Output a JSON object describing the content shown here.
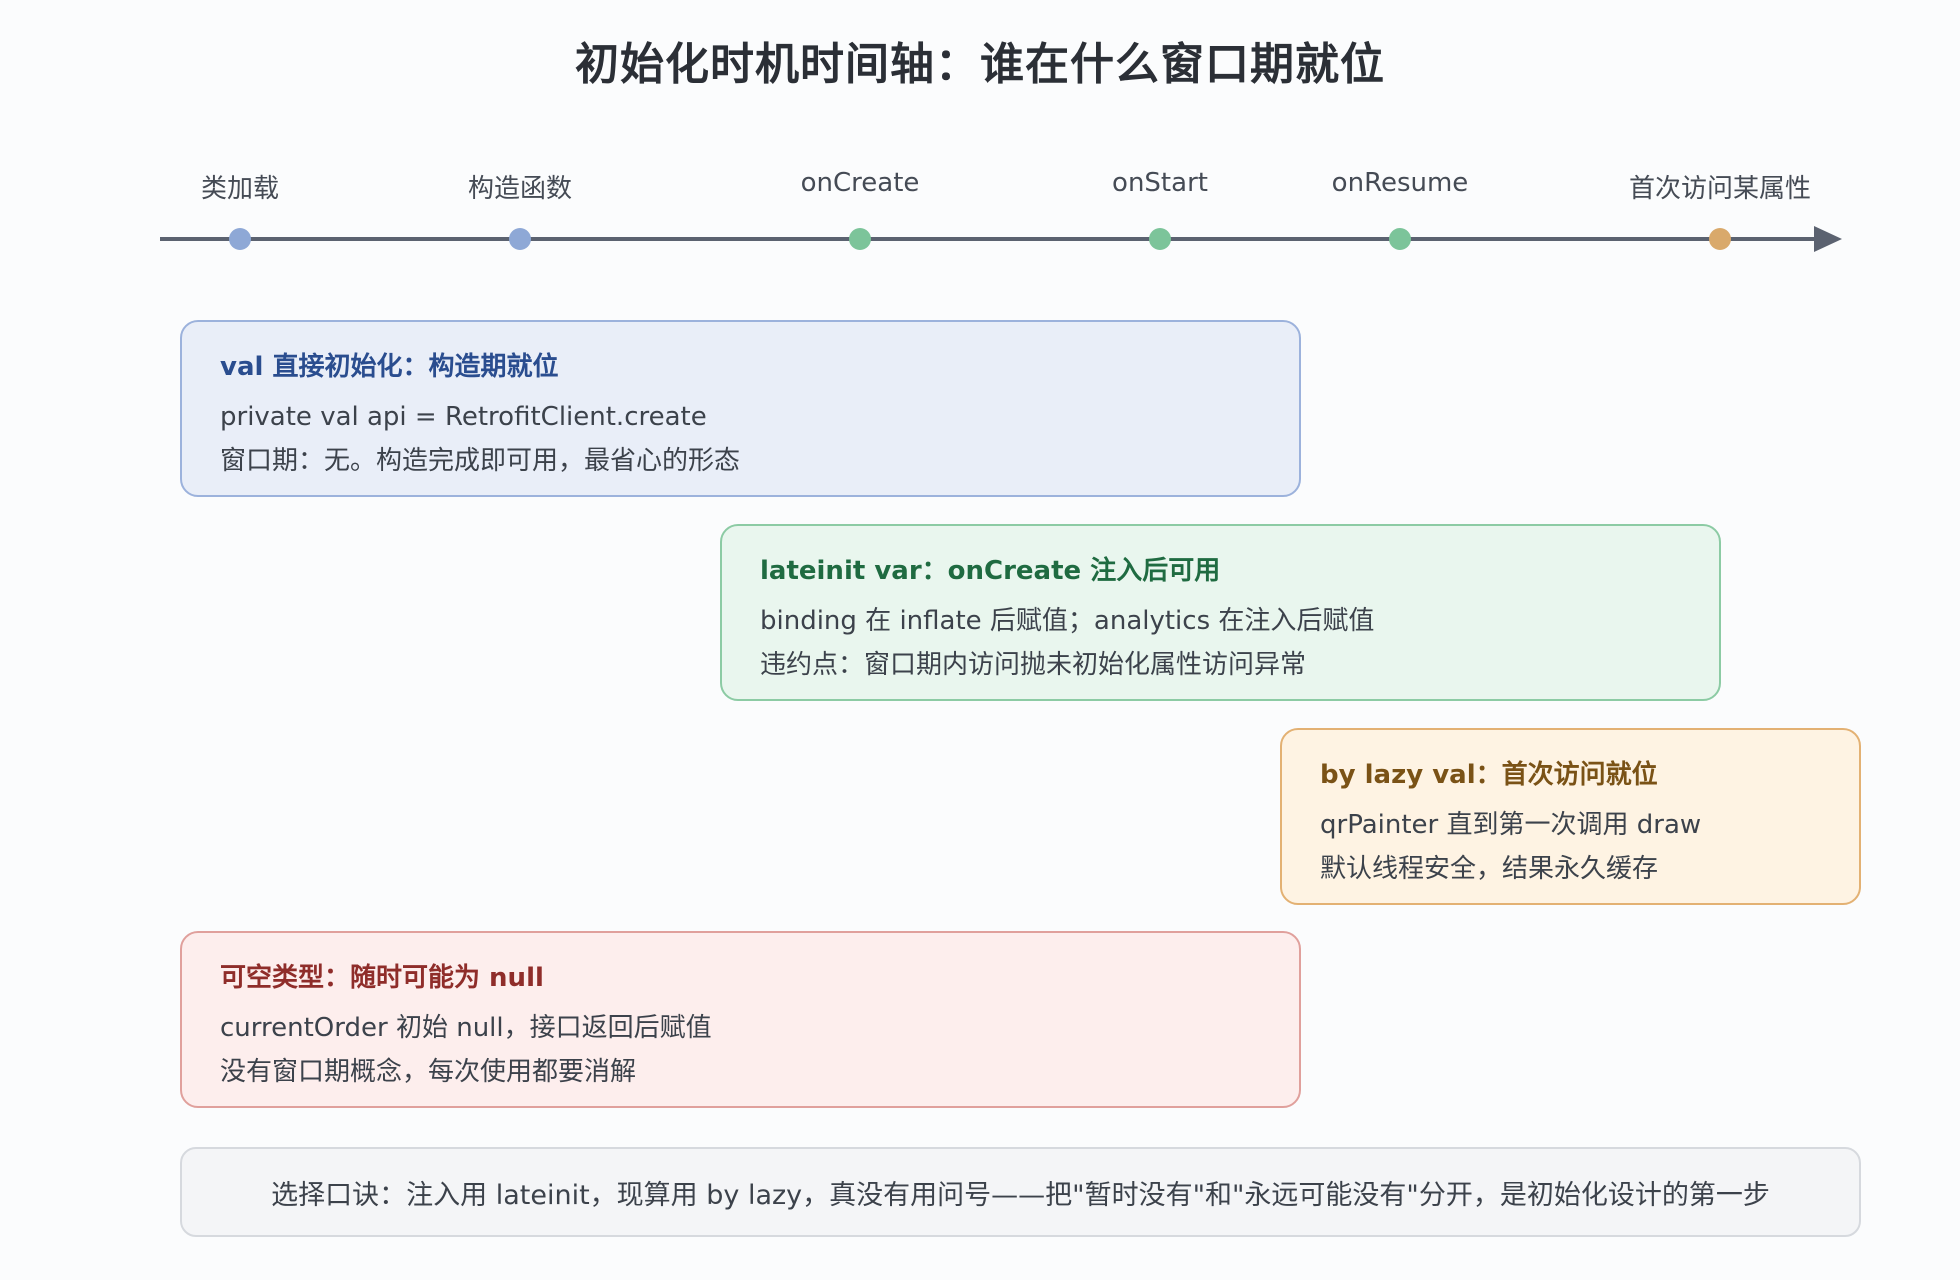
{
  "title": "初始化时机时间轴：谁在什么窗口期就位",
  "timeline": {
    "ticks": [
      {
        "label": "类加载",
        "color": "#8ea8d6"
      },
      {
        "label": "构造函数",
        "color": "#8ea8d6"
      },
      {
        "label": "onCreate",
        "color": "#7cc49a"
      },
      {
        "label": "onStart",
        "color": "#7cc49a"
      },
      {
        "label": "onResume",
        "color": "#7cc49a"
      },
      {
        "label": "首次访问某属性",
        "color": "#d9a96b"
      }
    ],
    "axis_color": "#5b6270"
  },
  "cards": {
    "val": {
      "title": "val 直接初始化：构造期就位",
      "line1": "private val api = RetrofitClient.create",
      "line2": "窗口期：无。构造完成即可用，最省心的形态"
    },
    "lateinit": {
      "title": "lateinit var：onCreate 注入后可用",
      "line1": "binding 在 inflate 后赋值；analytics 在注入后赋值",
      "line2": "违约点：窗口期内访问抛未初始化属性访问异常"
    },
    "lazy": {
      "title": "by lazy val：首次访问就位",
      "line1": "qrPainter 直到第一次调用 draw",
      "line2": "默认线程安全，结果永久缓存"
    },
    "nullable": {
      "title": "可空类型：随时可能为 null",
      "line1": "currentOrder 初始 null，接口返回后赋值",
      "line2": "没有窗口期概念，每次使用都要消解"
    }
  },
  "tip": "选择口诀：注入用 lateinit，现算用 by lazy，真没有用问号——把\"暂时没有\"和\"永远可能没有\"分开，是初始化设计的第一步"
}
